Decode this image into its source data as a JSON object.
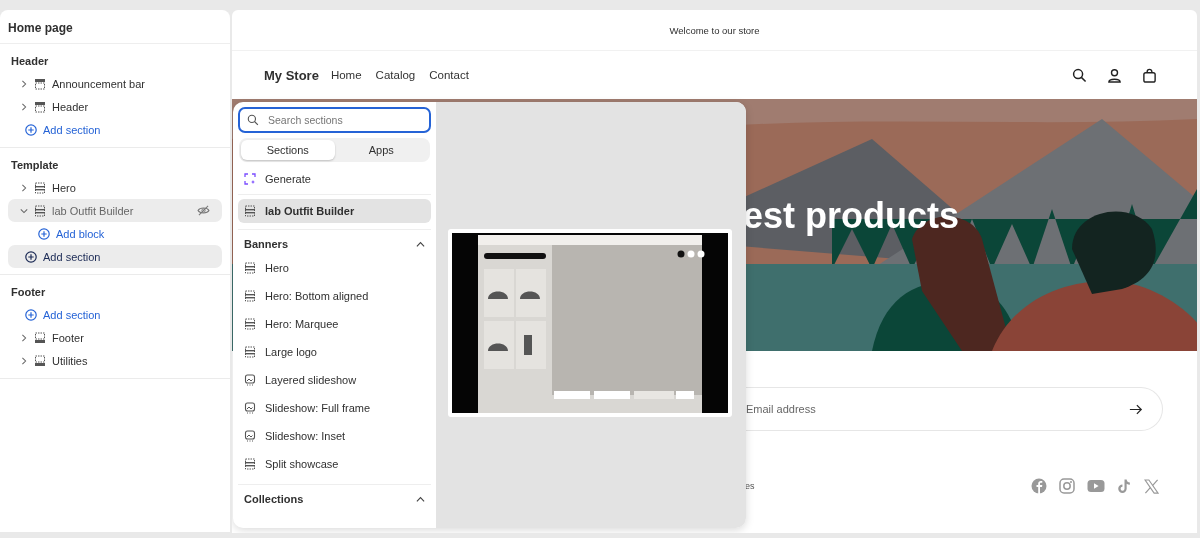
{
  "sidebar": {
    "title": "Home page",
    "groups": [
      {
        "title": "Header",
        "items": [
          {
            "kind": "header_section",
            "label": "Announcement bar",
            "expanded": false,
            "hidden": false,
            "selected": false
          },
          {
            "kind": "header_section",
            "label": "Header",
            "expanded": false,
            "hidden": false,
            "selected": false
          },
          {
            "kind": "add",
            "label": "Add section",
            "selected": false
          }
        ]
      },
      {
        "title": "Template",
        "items": [
          {
            "kind": "section",
            "label": "Hero",
            "expanded": false,
            "hidden": false,
            "selected": false
          },
          {
            "kind": "section",
            "label": "lab Outfit Builder",
            "expanded": true,
            "hidden": true,
            "selected": true,
            "children": [
              {
                "kind": "add",
                "label": "Add block",
                "selected": false
              }
            ]
          },
          {
            "kind": "add",
            "label": "Add section",
            "selected": true
          }
        ]
      },
      {
        "title": "Footer",
        "items": [
          {
            "kind": "add",
            "label": "Add section",
            "selected": false
          },
          {
            "kind": "footer_section",
            "label": "Footer",
            "expanded": false,
            "hidden": false,
            "selected": false
          },
          {
            "kind": "footer_section",
            "label": "Utilities",
            "expanded": false,
            "hidden": false,
            "selected": false
          }
        ]
      }
    ]
  },
  "store": {
    "announcement": "Welcome to our store",
    "logo": "My Store",
    "nav": [
      "Home",
      "Catalog",
      "Contact"
    ],
    "hero_heading": "est products",
    "newsletter": {
      "placeholder": "Email address"
    },
    "footer_text": "es"
  },
  "picker": {
    "search": {
      "placeholder": "Search sections"
    },
    "tabs": [
      {
        "label": "Sections",
        "selected": true
      },
      {
        "label": "Apps",
        "selected": false
      }
    ],
    "generate": "Generate",
    "current": {
      "label": "lab Outfit Builder",
      "selected": true
    },
    "categories": [
      {
        "title": "Banners",
        "expanded": true,
        "items": [
          {
            "label": "Hero",
            "kind": "banner"
          },
          {
            "label": "Hero: Bottom aligned",
            "kind": "banner"
          },
          {
            "label": "Hero: Marquee",
            "kind": "banner"
          },
          {
            "label": "Large logo",
            "kind": "banner"
          },
          {
            "label": "Layered slideshow",
            "kind": "slideshow"
          },
          {
            "label": "Slideshow: Full frame",
            "kind": "slideshow"
          },
          {
            "label": "Slideshow: Inset",
            "kind": "slideshow"
          },
          {
            "label": "Split showcase",
            "kind": "banner"
          }
        ]
      },
      {
        "title": "Collections",
        "expanded": true
      }
    ]
  }
}
